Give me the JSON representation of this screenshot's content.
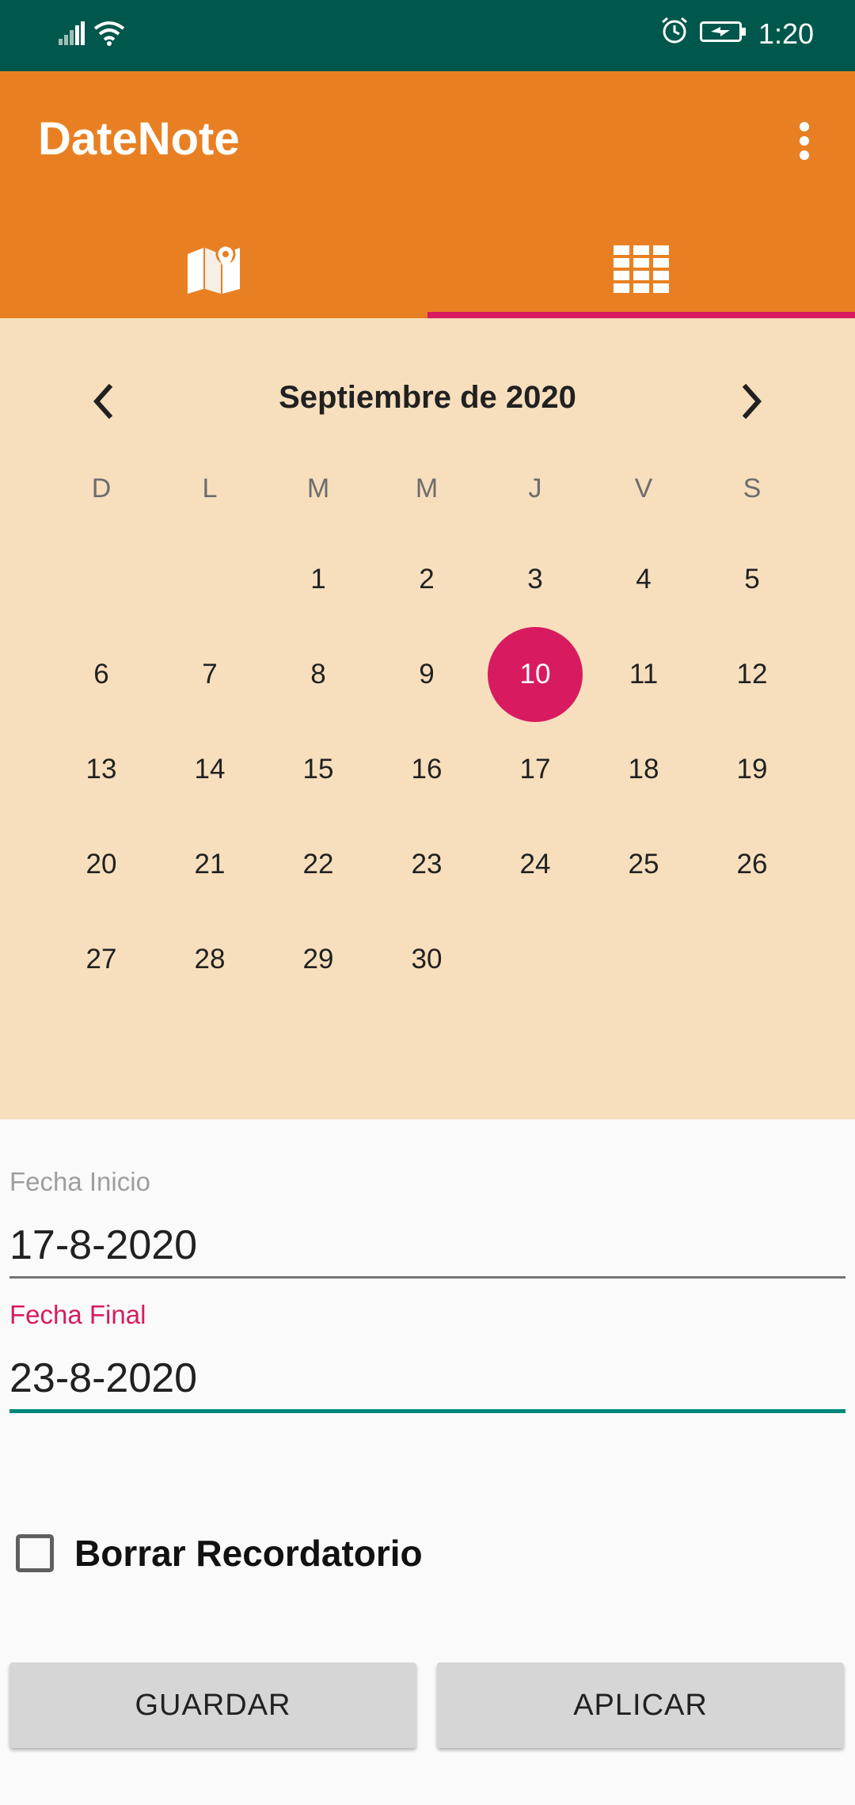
{
  "status_bar": {
    "time": "1:20",
    "icons": [
      "signal-icon",
      "wifi-icon",
      "alarm-icon",
      "battery-icon"
    ]
  },
  "toolbar": {
    "title": "DateNote",
    "overflow_icon": "more-vert-icon",
    "tabs": [
      {
        "icon": "map-icon",
        "selected": false
      },
      {
        "icon": "calendar-grid-icon",
        "selected": true
      }
    ]
  },
  "calendar": {
    "month_title": "Septiembre de 2020",
    "weekdays": [
      "D",
      "L",
      "M",
      "M",
      "J",
      "V",
      "S"
    ],
    "weeks": [
      [
        "",
        "",
        "1",
        "2",
        "3",
        "4",
        "5"
      ],
      [
        "6",
        "7",
        "8",
        "9",
        "10",
        "11",
        "12"
      ],
      [
        "13",
        "14",
        "15",
        "16",
        "17",
        "18",
        "19"
      ],
      [
        "20",
        "21",
        "22",
        "23",
        "24",
        "25",
        "26"
      ],
      [
        "27",
        "28",
        "29",
        "30",
        "",
        "",
        ""
      ]
    ],
    "selected_day": "10"
  },
  "form": {
    "start_label": "Fecha Inicio",
    "start_value": "17-8-2020",
    "end_label": "Fecha Final",
    "end_value": "23-8-2020",
    "checkbox_label": "Borrar Recordatorio",
    "checkbox_checked": false,
    "save_label": "GUARDAR",
    "apply_label": "APLICAR"
  },
  "colors": {
    "status_bar": "#00574b",
    "toolbar": "#e88023",
    "accent": "#d81b60",
    "calendar_bg": "#f7dfbd",
    "focus_underline": "#00897b"
  }
}
